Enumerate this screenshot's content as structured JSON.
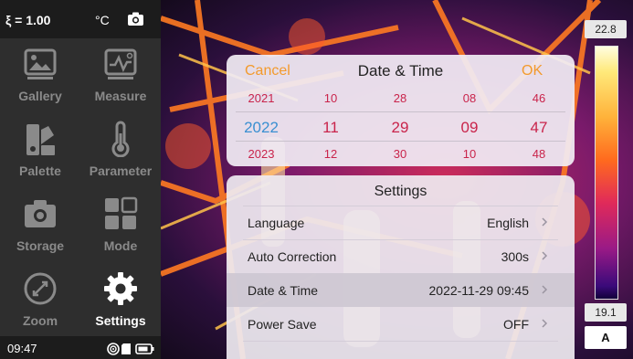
{
  "topbar": {
    "emissivity": "ξ = 1.00",
    "unit": "°C",
    "camera_icon": "camera-icon"
  },
  "menu": [
    {
      "label": "Gallery",
      "icon": "gallery-icon",
      "active": false
    },
    {
      "label": "Measure",
      "icon": "measure-icon",
      "active": false
    },
    {
      "label": "Palette",
      "icon": "palette-icon",
      "active": false
    },
    {
      "label": "Parameter",
      "icon": "thermometer-icon",
      "active": false
    },
    {
      "label": "Storage",
      "icon": "camera-icon",
      "active": false
    },
    {
      "label": "Mode",
      "icon": "mode-grid-icon",
      "active": false
    },
    {
      "label": "Zoom",
      "icon": "zoom-icon",
      "active": false
    },
    {
      "label": "Settings",
      "icon": "gear-icon",
      "active": true
    }
  ],
  "statusbar": {
    "time": "09:47",
    "icons": [
      "wifi-icon",
      "sd-card-icon",
      "battery-icon"
    ]
  },
  "scale": {
    "max": "22.8",
    "min": "19.1",
    "auto": "A"
  },
  "picker": {
    "cancel": "Cancel",
    "title": "Date & Time",
    "ok": "OK",
    "rows": {
      "prev": [
        "2021",
        "10",
        "28",
        "08",
        "46"
      ],
      "current": [
        "2022",
        "11",
        "29",
        "09",
        "47"
      ],
      "next": [
        "2023",
        "12",
        "30",
        "10",
        "48"
      ]
    }
  },
  "settings": {
    "title": "Settings",
    "items": [
      {
        "label": "Language",
        "value": "English"
      },
      {
        "label": "Auto Correction",
        "value": "300s"
      },
      {
        "label": "Date & Time",
        "value": "2022-11-29 09:45"
      },
      {
        "label": "Power Save",
        "value": "OFF"
      }
    ]
  },
  "colors": {
    "accent_orange": "#f39a2c",
    "picker_red": "#c9244b",
    "year_blue": "#3a8fd1"
  }
}
